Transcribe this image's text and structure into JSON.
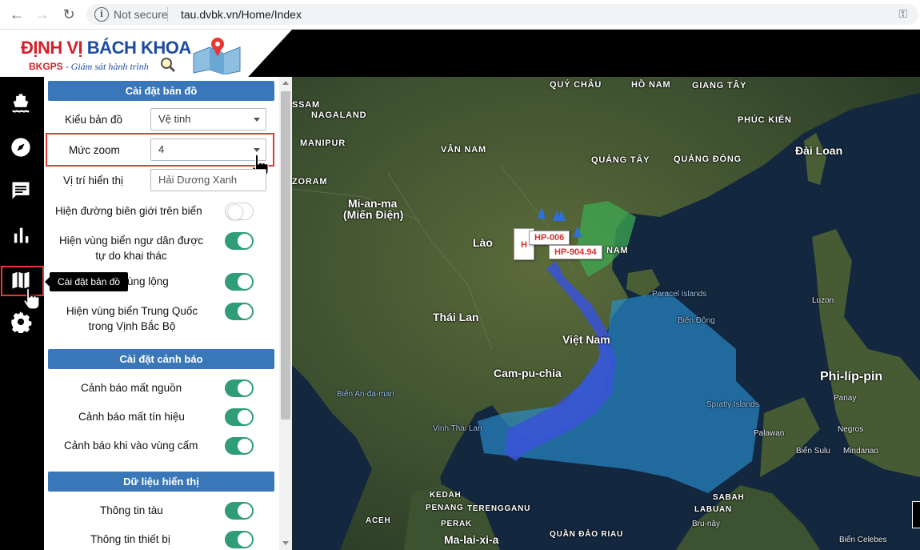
{
  "browser": {
    "security": "Not secure",
    "url": "tau.dvbk.vn/Home/Index"
  },
  "logo": {
    "title_red": "ĐỊNH VỊ ",
    "title_blue": "BÁCH KHOA",
    "sub_brand": "BKGPS",
    "sub_text": " - Giám sát hành trình"
  },
  "iconbar": {
    "items": [
      "ship-icon",
      "compass-icon",
      "chat-icon",
      "chart-icon",
      "map-icon",
      "gear-icon"
    ],
    "tooltip": "Cài đặt bản đồ"
  },
  "panel": {
    "map_settings": {
      "title": "Cài đặt bản đồ",
      "map_type_label": "Kiểu bản đồ",
      "map_type_value": "Vệ tinh",
      "zoom_label": "Mức zoom",
      "zoom_value": "4",
      "position_label": "Vị trí hiển thị",
      "position_value": "Hải Dương Xanh",
      "toggles": [
        {
          "label": "Hiện đường biên giới trên biển",
          "on": false
        },
        {
          "label": "Hiện vùng biển ngư dân được tự do khai thác",
          "on": true
        },
        {
          "label": "ùng lộng",
          "on": true
        },
        {
          "label": "Hiện vùng biển Trung Quốc trong Vịnh Bắc Bộ",
          "on": true
        }
      ]
    },
    "alert_settings": {
      "title": "Cài đặt cảnh báo",
      "toggles": [
        {
          "label": "Cảnh báo mất nguồn",
          "on": true
        },
        {
          "label": "Cảnh báo mất tín hiệu",
          "on": true
        },
        {
          "label": "Cảnh báo khi vào vùng cấm",
          "on": true
        }
      ]
    },
    "display_data": {
      "title": "Dữ liệu hiển thị",
      "toggles": [
        {
          "label": "Thông tin tàu",
          "on": true
        },
        {
          "label": "Thông tin thiết bị",
          "on": true
        }
      ]
    }
  },
  "map": {
    "labels": [
      "SSAM",
      "NAGALAND",
      "MANIPUR",
      "ZORAM",
      "QUÝ CHÂU",
      "HỒ NAM",
      "GIANG TÂY",
      "PHÚC KIẾN",
      "VÂN NAM",
      "QUẢNG TÂY",
      "QUẢNG ĐÔNG",
      "Đài Loan",
      "Mi-an-ma",
      "(Miến Điện)",
      "Lào",
      "Thái Lan",
      "Việt Nam",
      "Cam-pu-chia",
      "Phi-líp-pin",
      "Luzon",
      "Paracel Islands",
      "Biển Đông",
      "Spratly Islands",
      "Biển An-đa-man",
      "Vịnh Thái Lan",
      "Panay",
      "Negros",
      "Palawan",
      "Biển Sulu",
      "Mindanao",
      "KEDAH",
      "PENANG",
      "TERENGGANU",
      "ACEH",
      "PERAK",
      "Ma-lai-xi-a",
      "QUẦN ĐẢO RIAU",
      "SABAH",
      "LABUAN",
      "Bru-nây",
      "Biển Celebes",
      "NAM"
    ],
    "vessel_tags": [
      "HP-006",
      "HP-904.94",
      "H"
    ]
  },
  "colors": {
    "accent": "#3a77b8",
    "toggle_on": "#2e9d78",
    "highlight": "#e53935",
    "vessel_tag_text": "#d32f2f"
  }
}
